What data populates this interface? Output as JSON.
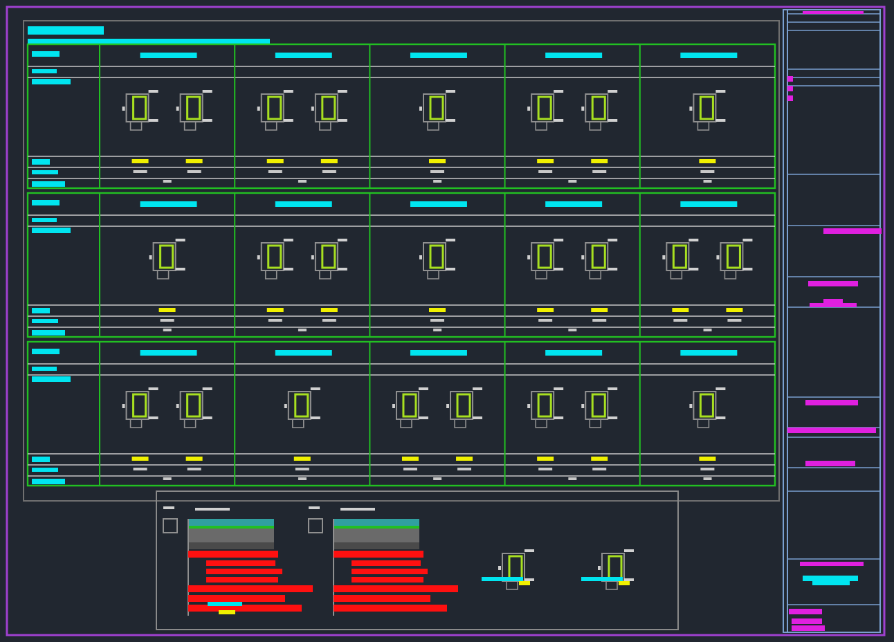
{
  "sections": [
    {
      "cells": [
        {
          "kind": "pair"
        },
        {
          "kind": "pair"
        },
        {
          "kind": "single"
        },
        {
          "kind": "pair"
        },
        {
          "kind": "single"
        }
      ]
    },
    {
      "cells": [
        {
          "kind": "single"
        },
        {
          "kind": "pair"
        },
        {
          "kind": "single"
        },
        {
          "kind": "pair"
        },
        {
          "kind": "pair"
        }
      ]
    },
    {
      "cells": [
        {
          "kind": "pair"
        },
        {
          "kind": "single"
        },
        {
          "kind": "pair"
        },
        {
          "kind": "pair"
        },
        {
          "kind": "single"
        }
      ]
    }
  ],
  "detail_sheet": {
    "details": [
      {
        "kind": "layered"
      },
      {
        "kind": "layered"
      },
      {
        "kind": "section"
      },
      {
        "kind": "section"
      }
    ]
  }
}
